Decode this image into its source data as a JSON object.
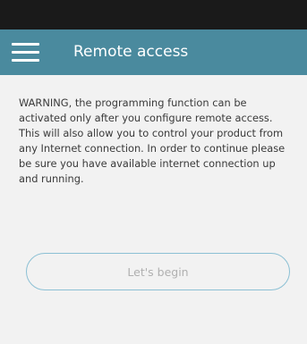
{
  "app_bar": {
    "title": "Remote access",
    "menu_icon": "hamburger-menu-icon",
    "color": "#4a8a9e"
  },
  "status_bar": {
    "color": "#1a1a1a"
  },
  "main": {
    "warning_text": "WARNING, the programming function can be activated only after you configure remote access. This will also allow you to control your product from any Internet connection. In order to continue please be sure you have available internet connection up and running.",
    "begin_button_label": "Let's begin",
    "button_border_color": "#8cc0d4"
  }
}
